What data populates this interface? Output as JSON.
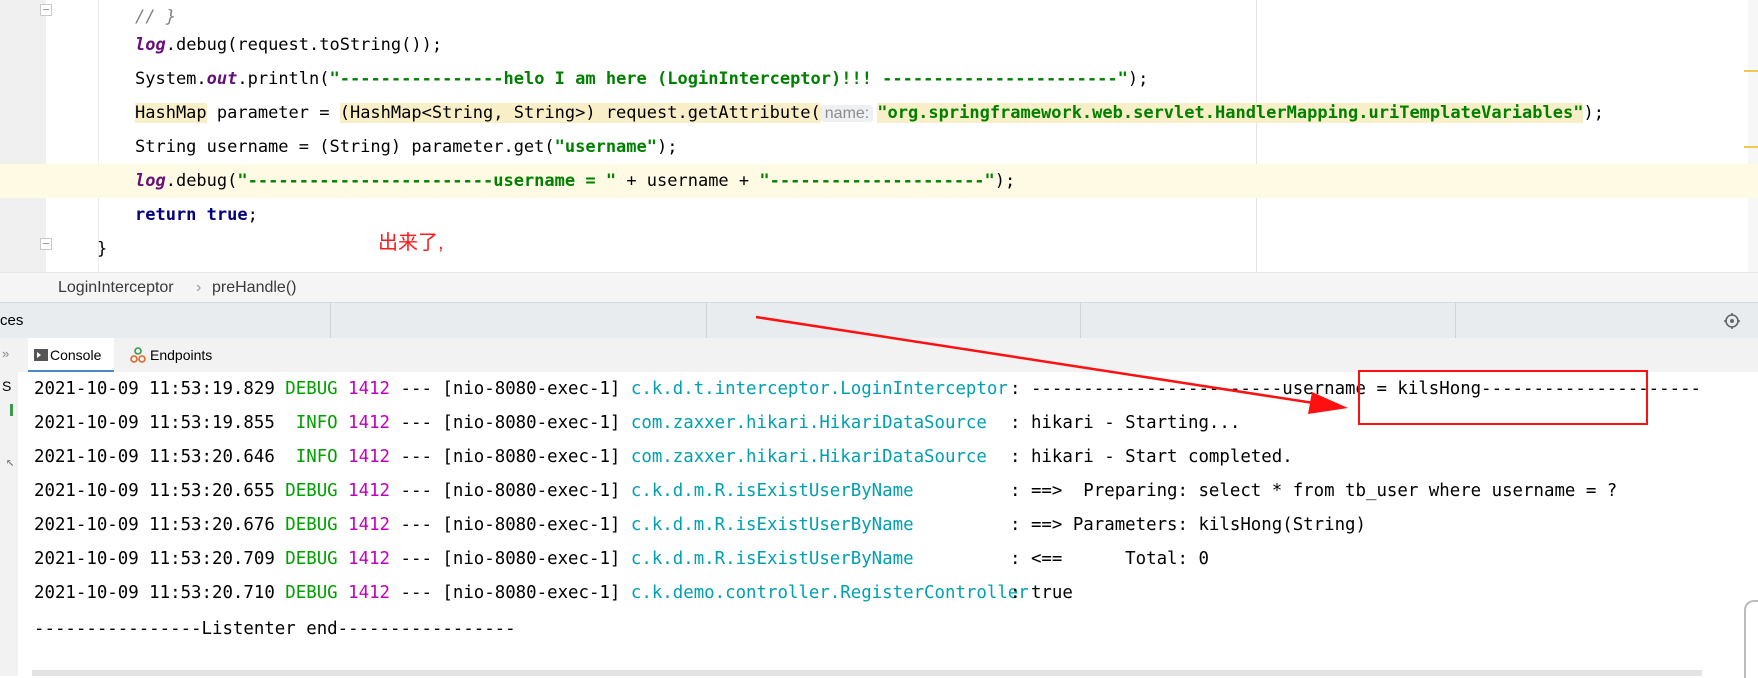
{
  "editor": {
    "lines": [
      {
        "id": "l0",
        "parts": [
          {
            "c": "cmt",
            "v": "// }"
          }
        ]
      },
      {
        "id": "l1",
        "parts": [
          {
            "c": "fld",
            "v": "log"
          },
          {
            "c": "",
            "v": ".debug(request.toString());"
          }
        ]
      },
      {
        "id": "l2",
        "parts": [
          {
            "c": "",
            "v": "System."
          },
          {
            "c": "fld",
            "v": "out"
          },
          {
            "c": "",
            "v": ".println("
          },
          {
            "c": "str",
            "v": "\"----------------helo I am here (LoginInterceptor)!!! -----------------------\""
          },
          {
            "c": "",
            "v": ");"
          }
        ]
      },
      {
        "id": "l3",
        "parts": [
          {
            "c": "hlb",
            "v": "HashMap"
          },
          {
            "c": "",
            "v": " parameter = "
          },
          {
            "c": "hlb",
            "v": "(HashMap<String, String>) request.getAttribute("
          },
          {
            "c": "hint",
            "v": "name:"
          },
          {
            "c": "hlbstr",
            "v": "\"org.springframework.web.servlet.HandlerMapping.uriTemplateVariables\""
          },
          {
            "c": "",
            "v": ");"
          }
        ]
      },
      {
        "id": "l4",
        "parts": [
          {
            "c": "",
            "v": "String username = (String) parameter.get("
          },
          {
            "c": "str",
            "v": "\"username\""
          },
          {
            "c": "",
            "v": ");"
          }
        ]
      },
      {
        "id": "l5",
        "parts": [
          {
            "c": "fld",
            "v": "log"
          },
          {
            "c": "",
            "v": ".debug("
          },
          {
            "c": "str",
            "v": "\"------------------------username = \""
          },
          {
            "c": "",
            "v": " + username + "
          },
          {
            "c": "str",
            "v": "\"---------------------\""
          },
          {
            "c": "",
            "v": ");"
          }
        ]
      },
      {
        "id": "l6",
        "parts": [
          {
            "c": "kw",
            "v": "return"
          },
          {
            "c": "",
            "v": " "
          },
          {
            "c": "kw",
            "v": "true"
          },
          {
            "c": "",
            "v": ";"
          }
        ]
      },
      {
        "id": "l7",
        "parts": [
          {
            "c": "",
            "v": "}"
          }
        ]
      }
    ],
    "annotation": "出来了,"
  },
  "breadcrumb": {
    "class_name": "LoginInterceptor",
    "method_name": "preHandle()",
    "sep": "›"
  },
  "services": {
    "title": "ces"
  },
  "tooltabs": {
    "console": "Console",
    "endpoints": "Endpoints"
  },
  "console": {
    "rows": [
      {
        "ts": "2021-10-09 11:53:19.829",
        "level": "DEBUG",
        "pid": "1412",
        "thread": "--- [nio-8080-exec-1]",
        "logger": "c.k.d.t.interceptor.LoginInterceptor",
        "msg": ": ------------------------username = kilsHong---------------------"
      },
      {
        "ts": "2021-10-09 11:53:19.855",
        "level": " INFO",
        "pid": "1412",
        "thread": "--- [nio-8080-exec-1]",
        "logger": "com.zaxxer.hikari.HikariDataSource",
        "msg": ": hikari - Starting..."
      },
      {
        "ts": "2021-10-09 11:53:20.646",
        "level": " INFO",
        "pid": "1412",
        "thread": "--- [nio-8080-exec-1]",
        "logger": "com.zaxxer.hikari.HikariDataSource",
        "msg": ": hikari - Start completed."
      },
      {
        "ts": "2021-10-09 11:53:20.655",
        "level": "DEBUG",
        "pid": "1412",
        "thread": "--- [nio-8080-exec-1]",
        "logger": "c.k.d.m.R.isExistUserByName",
        "msg": ": ==>  Preparing: select * from tb_user where username = ?"
      },
      {
        "ts": "2021-10-09 11:53:20.676",
        "level": "DEBUG",
        "pid": "1412",
        "thread": "--- [nio-8080-exec-1]",
        "logger": "c.k.d.m.R.isExistUserByName",
        "msg": ": ==> Parameters: kilsHong(String)"
      },
      {
        "ts": "2021-10-09 11:53:20.709",
        "level": "DEBUG",
        "pid": "1412",
        "thread": "--- [nio-8080-exec-1]",
        "logger": "c.k.d.m.R.isExistUserByName",
        "msg": ": <==      Total: 0"
      },
      {
        "ts": "2021-10-09 11:53:20.710",
        "level": "DEBUG",
        "pid": "1412",
        "thread": "--- [nio-8080-exec-1]",
        "logger": "c.k.demo.controller.RegisterController",
        "msg": ": true"
      }
    ],
    "footer": "----------------Listenter end-----------------"
  },
  "colors": {
    "annotation_red": "#ff1a1a",
    "debug_green": "#00a000",
    "pid_magenta": "#c000c0",
    "logger_cyan": "#00a0b0"
  }
}
